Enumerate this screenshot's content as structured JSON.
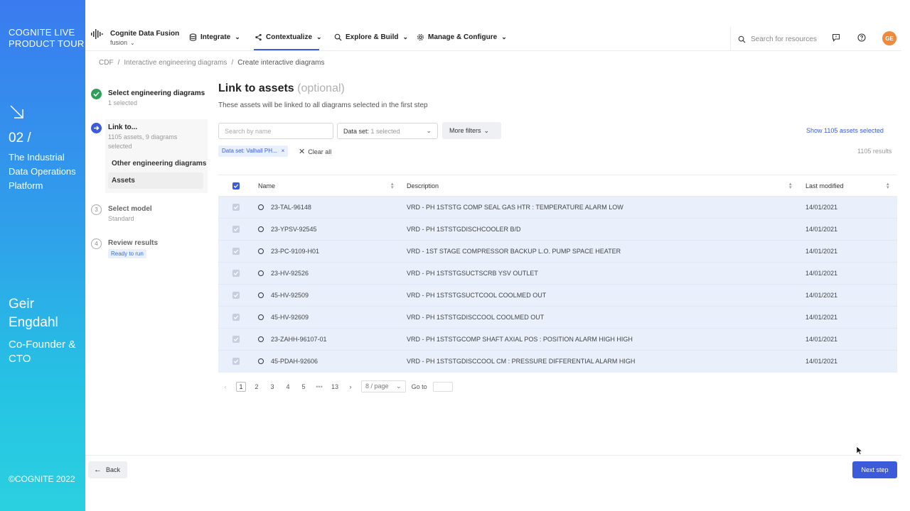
{
  "promo": {
    "tour": "COGNITE LIVE\nPRODUCT TOUR",
    "tour_line1": "COGNITE LIVE",
    "tour_line2": "PRODUCT TOUR",
    "number": "02 /",
    "platform": "The Industrial Data Operations Platform",
    "person_first": "Geir",
    "person_last": "Engdahl",
    "role": "Co-Founder & CTO",
    "copyright": "©COGNITE 2022"
  },
  "header": {
    "brand": "Cognite Data Fusion",
    "env": "fusion",
    "nav": [
      {
        "label": "Integrate",
        "icon": "database-icon"
      },
      {
        "label": "Contextualize",
        "icon": "share-nodes-icon"
      },
      {
        "label": "Explore & Build",
        "icon": "search-icon"
      },
      {
        "label": "Manage & Configure",
        "icon": "gear-icon"
      }
    ],
    "search_placeholder": "Search for resources",
    "avatar_initials": "GE",
    "accent_color": "#3b5bdb"
  },
  "breadcrumb": [
    "CDF",
    "Interactive engineering diagrams",
    "Create interactive diagrams"
  ],
  "steps": [
    {
      "title": "Select engineering diagrams",
      "sub": "1 selected",
      "state": "done"
    },
    {
      "title": "Link to...",
      "sub": "1105 assets, 9 diagrams selected",
      "state": "active",
      "children": [
        "Other engineering diagrams",
        "Assets"
      ],
      "selected_child": "Assets"
    },
    {
      "number": "3",
      "title": "Select model",
      "sub": "Standard",
      "state": "todo"
    },
    {
      "number": "4",
      "title": "Review results",
      "sub": "Ready to run",
      "state": "todo"
    }
  ],
  "main": {
    "title": "Link to assets",
    "title_optional": "(optional)",
    "description": "These assets will be linked to all diagrams selected in the first step",
    "search_placeholder": "Search by name",
    "dataset_label": "Data set:",
    "dataset_value": "1 selected",
    "more_filters": "More filters",
    "show_selected": "Show 1105 assets selected",
    "filter_tag": "Data set: Valhall PH...",
    "clear_all": "Clear all",
    "results": "1105 results"
  },
  "table": {
    "columns": [
      "Name",
      "Description",
      "Last modified"
    ],
    "rows": [
      {
        "name": "23-TAL-96148",
        "description": "VRD - PH 1STSTG COMP SEAL GAS HTR : TEMPERATURE ALARM LOW",
        "modified": "14/01/2021"
      },
      {
        "name": "23-YPSV-92545",
        "description": "VRD - PH 1STSTGDISCHCOOLER B/D",
        "modified": "14/01/2021"
      },
      {
        "name": "23-PC-9109-H01",
        "description": "VRD - 1ST STAGE COMPRESSOR BACKUP L.O. PUMP SPACE HEATER",
        "modified": "14/01/2021"
      },
      {
        "name": "23-HV-92526",
        "description": "VRD - PH 1STSTGSUCTSCRB YSV OUTLET",
        "modified": "14/01/2021"
      },
      {
        "name": "45-HV-92509",
        "description": "VRD - PH 1STSTGSUCTCOOL COOLMED OUT",
        "modified": "14/01/2021"
      },
      {
        "name": "45-HV-92609",
        "description": "VRD - PH 1STSTGDISCCOOL COOLMED OUT",
        "modified": "14/01/2021"
      },
      {
        "name": "23-ZAHH-96107-01",
        "description": "VRD - PH 1STSTGCOMP SHAFT AXIAL POS : POSITION ALARM HIGH HIGH",
        "modified": "14/01/2021"
      },
      {
        "name": "45-PDAH-92606",
        "description": "VRD - PH 1STSTGDISCCOOL CM : PRESSURE DIFFERENTIAL ALARM HIGH",
        "modified": "14/01/2021"
      }
    ]
  },
  "pagination": {
    "pages": [
      "1",
      "2",
      "3",
      "4",
      "5",
      "•••",
      "13"
    ],
    "current": "1",
    "page_size": "8 / page",
    "goto": "Go to"
  },
  "footer": {
    "back": "Back",
    "next": "Next step"
  }
}
